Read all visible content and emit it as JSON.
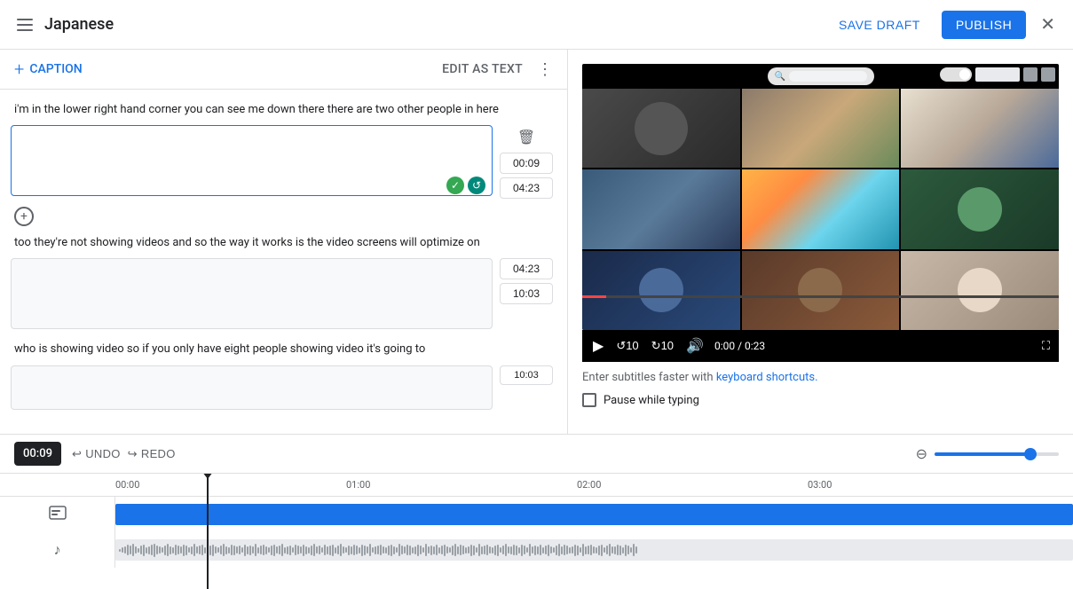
{
  "topBar": {
    "icon": "≡",
    "title": "Japanese",
    "saveDraftLabel": "SAVE DRAFT",
    "publishLabel": "PUBLISH",
    "closeIcon": "✕",
    "feedbackIcon": "!"
  },
  "leftPanel": {
    "addCaptionLabel": "CAPTION",
    "editAsTextLabel": "EDIT AS TEXT",
    "contextText1": "i'm in the lower right hand corner you can see  me down there there are two other people in here",
    "contextText2": "too they're not showing videos and so the way  it works is the video screens will optimize on",
    "contextText3": "who is showing video so if you only have  eight people showing video it's going to",
    "captions": [
      {
        "id": "c1",
        "text": "",
        "startTime": "00:09",
        "endTime": "04:23",
        "active": true
      },
      {
        "id": "c2",
        "text": "",
        "startTime": "04:23",
        "endTime": "10:03",
        "active": false
      },
      {
        "id": "c3",
        "text": "",
        "startTime": "10:03",
        "endTime": "",
        "active": false
      }
    ]
  },
  "rightPanel": {
    "subtitleHint": "Enter subtitles faster with",
    "keyboardShortcutsLink": "keyboard shortcuts.",
    "pauseWhileTypingLabel": "Pause while typing",
    "videoTime": "0:00 / 0:23",
    "playIcon": "▶",
    "replayIcon": "↺",
    "forwardIcon": "↻",
    "muteIcon": "🔊"
  },
  "bottomBar": {
    "timeCounter": "00:09",
    "undoLabel": "UNDO",
    "redoLabel": "REDO",
    "undoIcon": "↩",
    "redoIcon": "↪"
  },
  "timeline": {
    "ticks": [
      "00:00",
      "01:00",
      "02:00",
      "03:00"
    ],
    "tickPositions": [
      0,
      260,
      520,
      780
    ],
    "captionIcon": "≡",
    "audioIcon": "♪"
  }
}
